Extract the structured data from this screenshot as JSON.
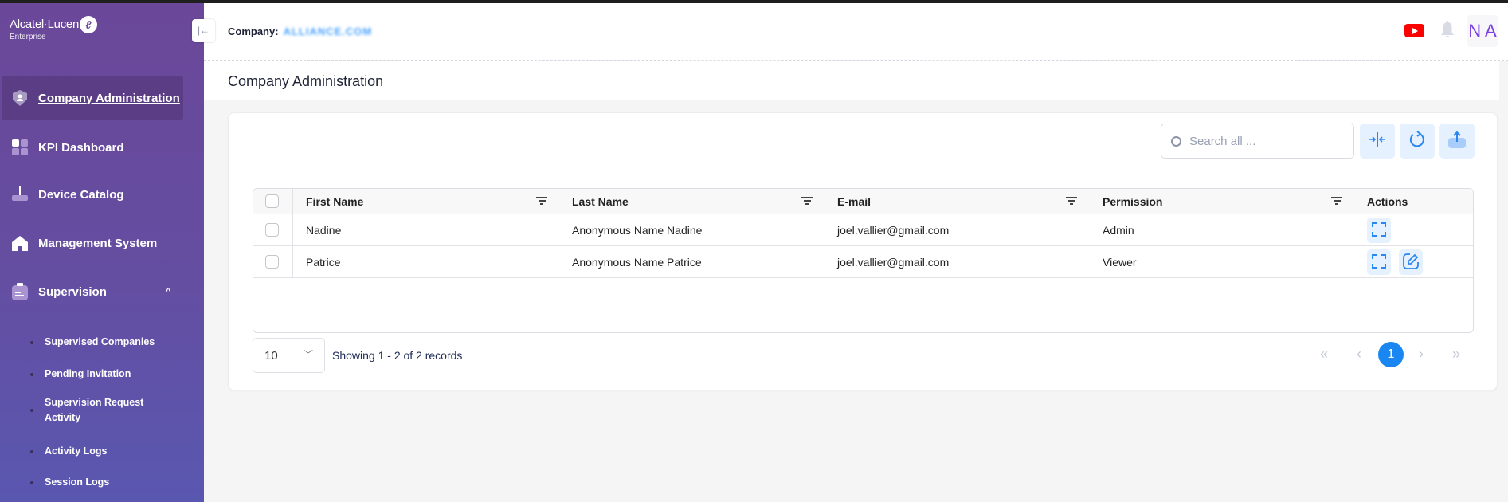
{
  "sidebar": {
    "brand": "Alcatel·Lucent",
    "brand_sub": "Enterprise",
    "items": [
      {
        "label": "Company Administration",
        "icon": "shield-user-icon",
        "active": true
      },
      {
        "label": "KPI Dashboard",
        "icon": "dashboard-grid-icon"
      },
      {
        "label": "Device Catalog",
        "icon": "router-icon"
      },
      {
        "label": "Management System",
        "icon": "home-icon"
      },
      {
        "label": "Supervision",
        "icon": "clipboard-icon",
        "expanded": true
      }
    ],
    "sub_items": [
      {
        "label": "Supervised Companies"
      },
      {
        "label": "Pending Invitation"
      },
      {
        "label": "Supervision Request Activity"
      },
      {
        "label": "Activity Logs"
      },
      {
        "label": "Session Logs"
      }
    ]
  },
  "header": {
    "company_label": "Company:",
    "company_value": "ALLIANCE.COM",
    "avatar_initials": "N A"
  },
  "page": {
    "title": "Company Administration"
  },
  "toolbar": {
    "search_placeholder": "Search all ..."
  },
  "table": {
    "columns": [
      "First Name",
      "Last Name",
      "E-mail",
      "Permission",
      "Actions"
    ],
    "rows": [
      {
        "first": "Nadine",
        "last": "Anonymous Name Nadine",
        "email": "joel.vallier@gmail.com",
        "permission": "Admin",
        "actions": [
          "view"
        ]
      },
      {
        "first": "Patrice",
        "last": "Anonymous Name Patrice",
        "email": "joel.vallier@gmail.com",
        "permission": "Viewer",
        "actions": [
          "view",
          "edit"
        ]
      }
    ]
  },
  "pagination": {
    "page_size": "10",
    "showing": "Showing 1 - 2 of 2 records",
    "current_page": "1",
    "first": "«",
    "prev": "‹",
    "next": "›",
    "last": "»"
  },
  "colors": {
    "accent": "#1a86f2",
    "sidebar_top": "#6b4799",
    "sidebar_bottom": "#5a57b0",
    "avatar": "#7b3fe4"
  }
}
